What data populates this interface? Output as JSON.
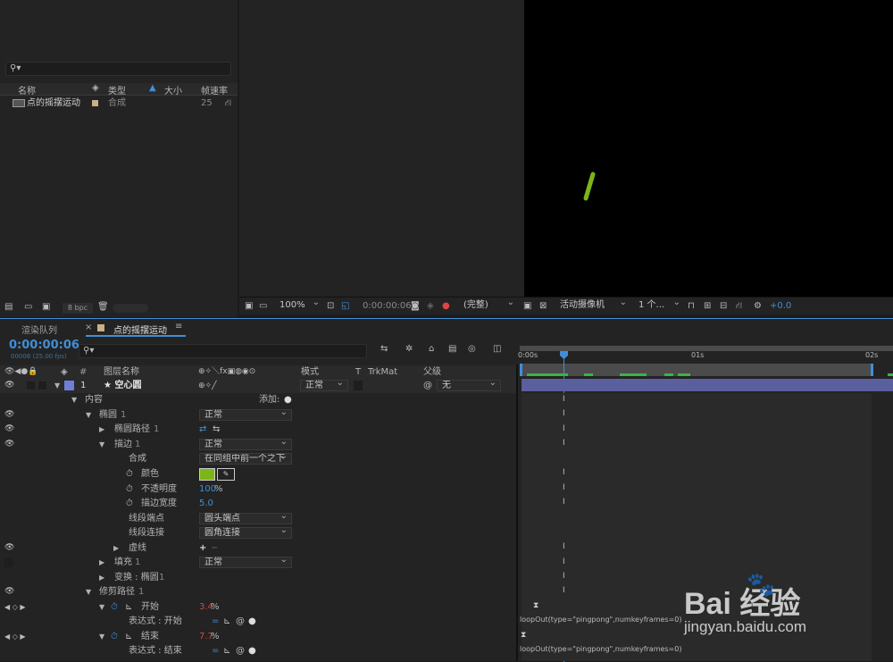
{
  "project": {
    "columns": {
      "name": "名称",
      "type": "类型",
      "size": "大小",
      "fps": "帧速率"
    },
    "item": {
      "name": "点的摇摆运动",
      "type": "合成",
      "fps": "25"
    },
    "bpc": "8 bpc"
  },
  "viewer": {
    "zoom": "100%",
    "timecode": "0:00:00:06",
    "resolution": "(完整)",
    "camera": "活动摄像机",
    "views": "1 个...",
    "exposure": "+0.0"
  },
  "tabs": {
    "render_queue": "渲染队列",
    "comp": "点的摇摆运动"
  },
  "timeline": {
    "timecode": "0:00:00:06",
    "frame_info": "00006 (25.00 fps)",
    "col_name": "图层名称",
    "col_mode": "模式",
    "col_t": "T",
    "col_trkmat": "TrkMat",
    "col_parent": "父级",
    "ruler": [
      "0:00s",
      "01s",
      "02s"
    ],
    "layer": {
      "num": "1",
      "name": "★ 空心圆",
      "mode": "正常",
      "parent": "无"
    },
    "rows": {
      "contents": "内容",
      "add": "添加:",
      "ellipse": "椭圆",
      "ellipse_n": "1",
      "ellipse_mode": "正常",
      "ellipse_path": "椭圆路径",
      "ellipse_path_n": "1",
      "stroke": "描边",
      "stroke_n": "1",
      "stroke_mode": "正常",
      "composite": "合成",
      "composite_val": "在同组中前一个之下",
      "color": "颜色",
      "opacity": "不透明度",
      "opacity_val": "100",
      "pct": "%",
      "stroke_width": "描边宽度",
      "stroke_width_val": "5.0",
      "line_cap": "线段端点",
      "line_cap_val": "圆头端点",
      "line_join": "线段连接",
      "line_join_val": "圆角连接",
      "dashes": "虚线",
      "fill": "填充",
      "fill_n": "1",
      "fill_mode": "正常",
      "transform": "变换 : 椭圆",
      "transform_n": "1",
      "trim": "修剪路径",
      "trim_n": "1",
      "start": "开始",
      "start_val": "3.4",
      "expr_start": "表达式 : 开始",
      "end": "结束",
      "end_val": "7.7",
      "expr_end": "表达式 : 结束"
    },
    "expression": "loopOut(type=\"pingpong\",numkeyframes=0)"
  },
  "colors": {
    "accent": "#3f8fd8",
    "stroke_color": "#7cb518",
    "label": "#6f7fd6"
  },
  "watermark": {
    "brand": "Bai 经验",
    "url": "jingyan.baidu.com"
  }
}
